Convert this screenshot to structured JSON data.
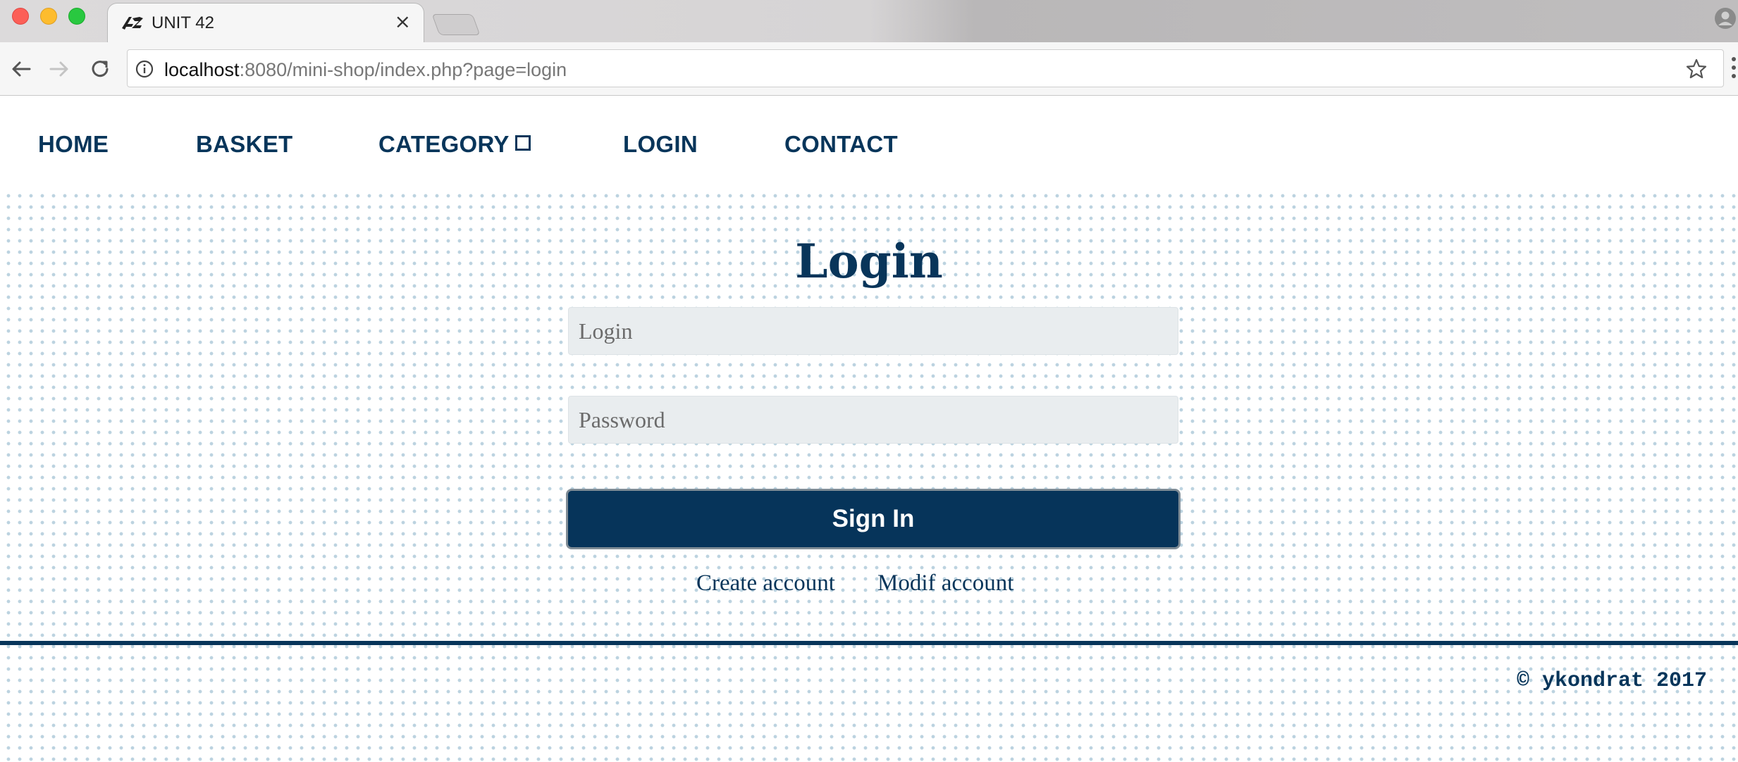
{
  "browser": {
    "tab_title": "UNIT 42",
    "tab_close": "×",
    "url_host": "localhost",
    "url_rest": ":8080/mini-shop/index.php?page=login"
  },
  "nav": {
    "items": [
      {
        "label": "HOME"
      },
      {
        "label": "BASKET"
      },
      {
        "label": "CATEGORY"
      },
      {
        "label": "LOGIN"
      },
      {
        "label": "CONTACT"
      }
    ]
  },
  "form": {
    "title": "Login",
    "login_placeholder": "Login",
    "password_placeholder": "Password",
    "submit_label": "Sign In",
    "create_account": "Create account",
    "modif_account": "Modif account"
  },
  "footer": {
    "copyright": "© ykondrat 2017"
  },
  "colors": {
    "brand": "#08355a",
    "button": "#06345a",
    "field_bg": "#e9edef",
    "dots": "#bcd3e0"
  },
  "icons": [
    "unit42-logo-icon",
    "close-icon",
    "back-arrow-icon",
    "forward-arrow-icon",
    "reload-icon",
    "info-icon",
    "star-icon",
    "menu-dots-icon",
    "profile-icon",
    "dropdown-box-icon"
  ]
}
